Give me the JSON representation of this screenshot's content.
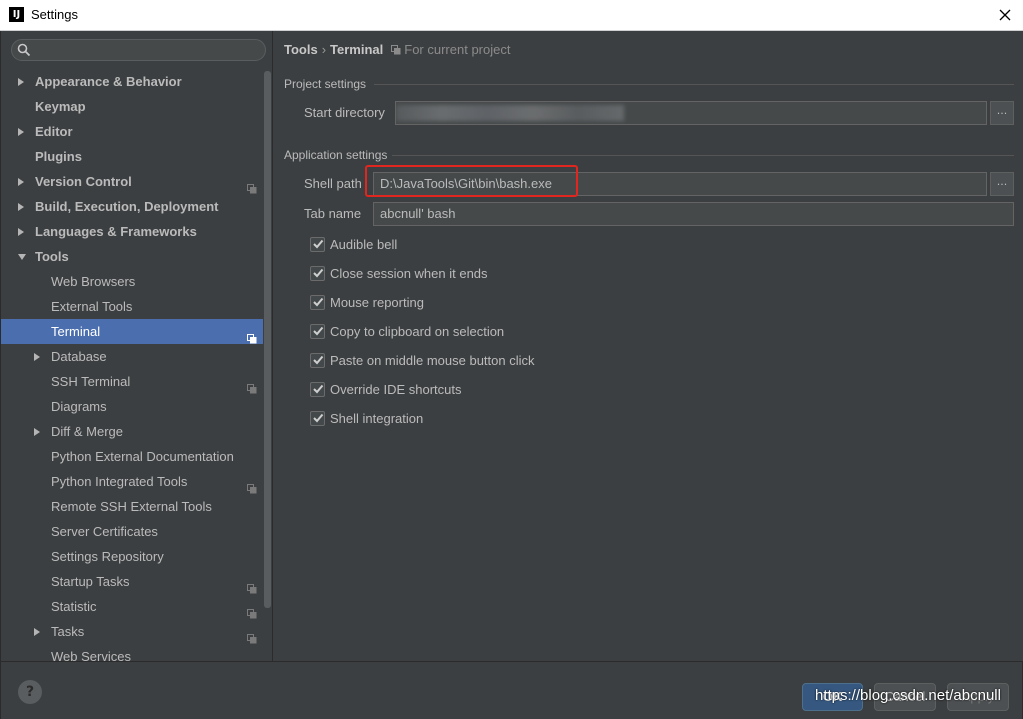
{
  "window": {
    "title": "Settings",
    "app_icon_text": "IJ"
  },
  "sidebar": {
    "search": {
      "placeholder": ""
    },
    "items": [
      {
        "label": "Appearance & Behavior",
        "bold": true,
        "level": 0,
        "arrow": "collapsed"
      },
      {
        "label": "Keymap",
        "bold": true,
        "level": 0,
        "arrow": "none"
      },
      {
        "label": "Editor",
        "bold": true,
        "level": 0,
        "arrow": "collapsed"
      },
      {
        "label": "Plugins",
        "bold": true,
        "level": 0,
        "arrow": "none"
      },
      {
        "label": "Version Control",
        "bold": true,
        "level": 0,
        "arrow": "collapsed",
        "project": true
      },
      {
        "label": "Build, Execution, Deployment",
        "bold": true,
        "level": 0,
        "arrow": "collapsed"
      },
      {
        "label": "Languages & Frameworks",
        "bold": true,
        "level": 0,
        "arrow": "collapsed"
      },
      {
        "label": "Tools",
        "bold": true,
        "level": 0,
        "arrow": "expanded"
      },
      {
        "label": "Web Browsers",
        "bold": false,
        "level": 1,
        "arrow": "none"
      },
      {
        "label": "External Tools",
        "bold": false,
        "level": 1,
        "arrow": "none"
      },
      {
        "label": "Terminal",
        "bold": false,
        "level": 1,
        "arrow": "none",
        "project": true,
        "selected": true
      },
      {
        "label": "Database",
        "bold": false,
        "level": 1,
        "arrow": "collapsed"
      },
      {
        "label": "SSH Terminal",
        "bold": false,
        "level": 1,
        "arrow": "none",
        "project": true
      },
      {
        "label": "Diagrams",
        "bold": false,
        "level": 1,
        "arrow": "none"
      },
      {
        "label": "Diff & Merge",
        "bold": false,
        "level": 1,
        "arrow": "collapsed"
      },
      {
        "label": "Python External Documentation",
        "bold": false,
        "level": 1,
        "arrow": "none"
      },
      {
        "label": "Python Integrated Tools",
        "bold": false,
        "level": 1,
        "arrow": "none",
        "project": true
      },
      {
        "label": "Remote SSH External Tools",
        "bold": false,
        "level": 1,
        "arrow": "none"
      },
      {
        "label": "Server Certificates",
        "bold": false,
        "level": 1,
        "arrow": "none"
      },
      {
        "label": "Settings Repository",
        "bold": false,
        "level": 1,
        "arrow": "none"
      },
      {
        "label": "Startup Tasks",
        "bold": false,
        "level": 1,
        "arrow": "none",
        "project": true
      },
      {
        "label": "Statistic",
        "bold": false,
        "level": 1,
        "arrow": "none",
        "project": true
      },
      {
        "label": "Tasks",
        "bold": false,
        "level": 1,
        "arrow": "collapsed",
        "project": true
      },
      {
        "label": "Web Services",
        "bold": false,
        "level": 1,
        "arrow": "none"
      }
    ]
  },
  "breadcrumb": {
    "parent": "Tools",
    "separator": "›",
    "current": "Terminal",
    "note": "For current project"
  },
  "project_settings": {
    "title": "Project settings",
    "start_directory_label": "Start directory",
    "start_directory_value": ""
  },
  "application_settings": {
    "title": "Application settings",
    "shell_path_label": "Shell path",
    "shell_path_value": "D:\\JavaTools\\Git\\bin\\bash.exe",
    "tab_name_label": "Tab name",
    "tab_name_value": "abcnull' bash",
    "browse_label": "...",
    "checkboxes": [
      {
        "label": "Audible bell",
        "checked": true
      },
      {
        "label": "Close session when it ends",
        "checked": true
      },
      {
        "label": "Mouse reporting",
        "checked": true
      },
      {
        "label": "Copy to clipboard on selection",
        "checked": true
      },
      {
        "label": "Paste on middle mouse button click",
        "checked": true
      },
      {
        "label": "Override IDE shortcuts",
        "checked": true
      },
      {
        "label": "Shell integration",
        "checked": true
      }
    ]
  },
  "footer": {
    "help": "?",
    "ok": "OK",
    "cancel": "Cancel",
    "apply": "Apply"
  },
  "watermark": "https://blog.csdn.net/abcnull",
  "colors": {
    "background": "#3c3f41",
    "selection": "#4b6eaf",
    "highlight_box": "#e0261e",
    "ok_button": "#365880"
  }
}
